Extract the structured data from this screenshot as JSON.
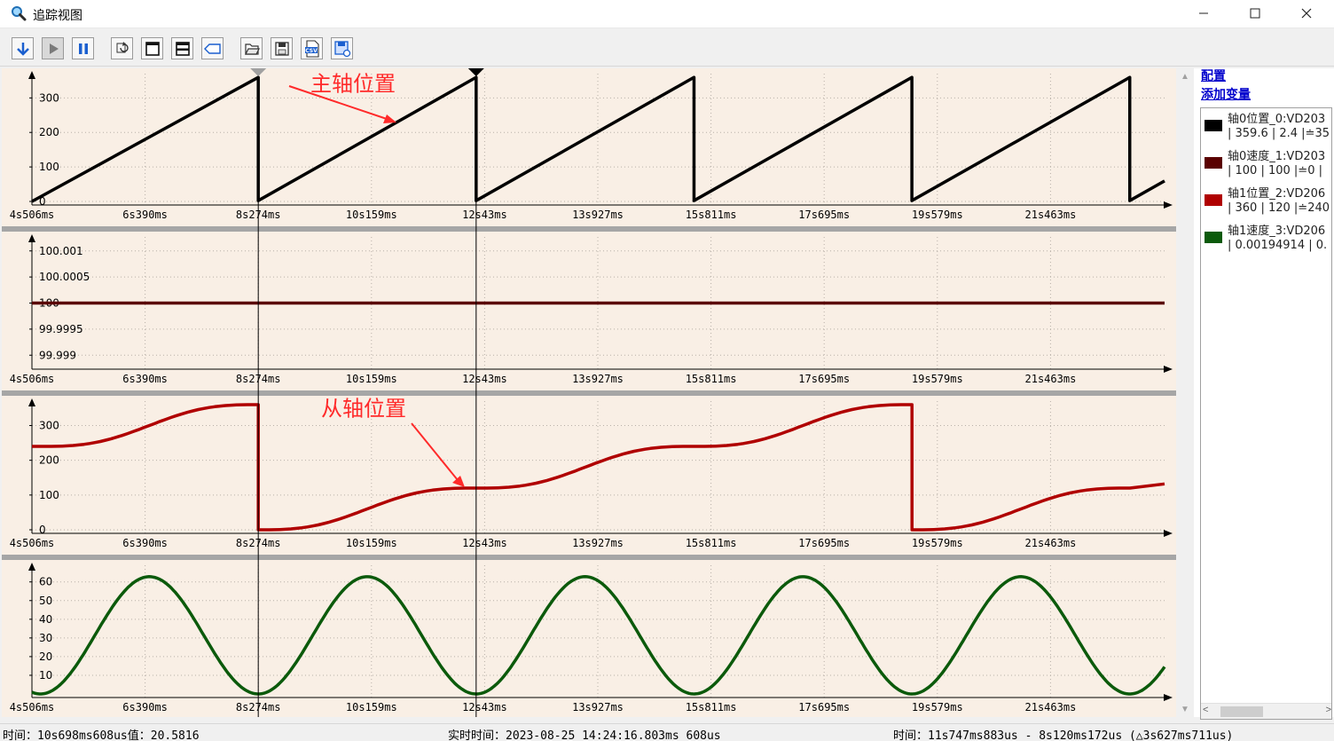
{
  "window": {
    "title": "追踪视图"
  },
  "toolbar": {
    "buttons": [
      {
        "name": "download-button",
        "icon": "arrow-down-icon"
      },
      {
        "name": "play-button",
        "icon": "play-icon"
      },
      {
        "name": "pause-button",
        "icon": "pause-icon"
      },
      {
        "name": "refresh-button",
        "icon": "refresh-icon"
      },
      {
        "name": "single-view-button",
        "icon": "window-icon"
      },
      {
        "name": "split-view-button",
        "icon": "split-window-icon"
      },
      {
        "name": "tag-button",
        "icon": "tag-icon"
      },
      {
        "name": "open-button",
        "icon": "folder-open-icon"
      },
      {
        "name": "save-button",
        "icon": "save-icon"
      },
      {
        "name": "export-csv-button",
        "icon": "csv-icon"
      },
      {
        "name": "save-config-button",
        "icon": "save-settings-icon"
      }
    ]
  },
  "links": {
    "config": "配置",
    "add_variable": "添加变量"
  },
  "legend": [
    {
      "name": "轴0位置_0:VD203",
      "values": "| 359.6 | 2.4 |≐35",
      "color": "#000000"
    },
    {
      "name": "轴0速度_1:VD203",
      "values": "| 100 | 100 |≐0 |",
      "color": "#5a0000"
    },
    {
      "name": "轴1位置_2:VD206",
      "values": "| 360 | 120 |≐240",
      "color": "#b00000"
    },
    {
      "name": "轴1速度_3:VD206",
      "values": "| 0.00194914 | 0.",
      "color": "#0b5a0b"
    }
  ],
  "annotations": {
    "master": "主轴位置",
    "slave": "从轴位置"
  },
  "x_ticks": [
    "4s506ms",
    "6s390ms",
    "8s274ms",
    "10s159ms",
    "12s43ms",
    "13s927ms",
    "15s811ms",
    "17s695ms",
    "19s579ms",
    "21s463ms"
  ],
  "chart_data": [
    {
      "type": "line",
      "series": [
        {
          "name": "轴0位置_0:VD203",
          "color": "#000000"
        }
      ],
      "y_ticks": [
        "0",
        "100",
        "200",
        "300"
      ],
      "ylim": [
        0,
        360
      ],
      "model": "sawtooth",
      "period_ms": 3627,
      "x_start_ms": 4506,
      "x_end_ms": 24110,
      "first_reset_ms": 8274
    },
    {
      "type": "line",
      "series": [
        {
          "name": "轴0速度_1:VD203",
          "color": "#5a0000"
        }
      ],
      "y_ticks": [
        "99.999",
        "99.9995",
        "100",
        "100.0005",
        "100.001"
      ],
      "ylim": [
        99.9988,
        100.0012
      ],
      "model": "constant",
      "value": 100
    },
    {
      "type": "line",
      "series": [
        {
          "name": "轴1位置_2:VD206",
          "color": "#b00000"
        }
      ],
      "y_ticks": [
        "0",
        "100",
        "200",
        "300"
      ],
      "ylim": [
        0,
        360
      ],
      "model": "cam-profile",
      "levels": [
        240,
        0,
        120,
        240,
        360
      ],
      "reset_ms": [
        8274,
        19157
      ]
    },
    {
      "type": "line",
      "series": [
        {
          "name": "轴1速度_3:VD206",
          "color": "#0b5a0b"
        }
      ],
      "y_ticks": [
        "10",
        "20",
        "30",
        "40",
        "50",
        "60"
      ],
      "ylim": [
        0,
        67
      ],
      "model": "sine",
      "peak": 62.8,
      "period_ms": 3627,
      "min_at_ms": 8274
    }
  ],
  "cursors": [
    {
      "name": "cursor-1",
      "time_ms": 8274
    },
    {
      "name": "cursor-2",
      "time_ms": 11901
    }
  ],
  "status": {
    "left": "时间：10s698ms608us值：20.5816",
    "middle": "实时时间：2023-08-25 14:24:16.803ms 608us",
    "right": "时间：11s747ms883us - 8s120ms172us (△3s627ms711us)"
  }
}
